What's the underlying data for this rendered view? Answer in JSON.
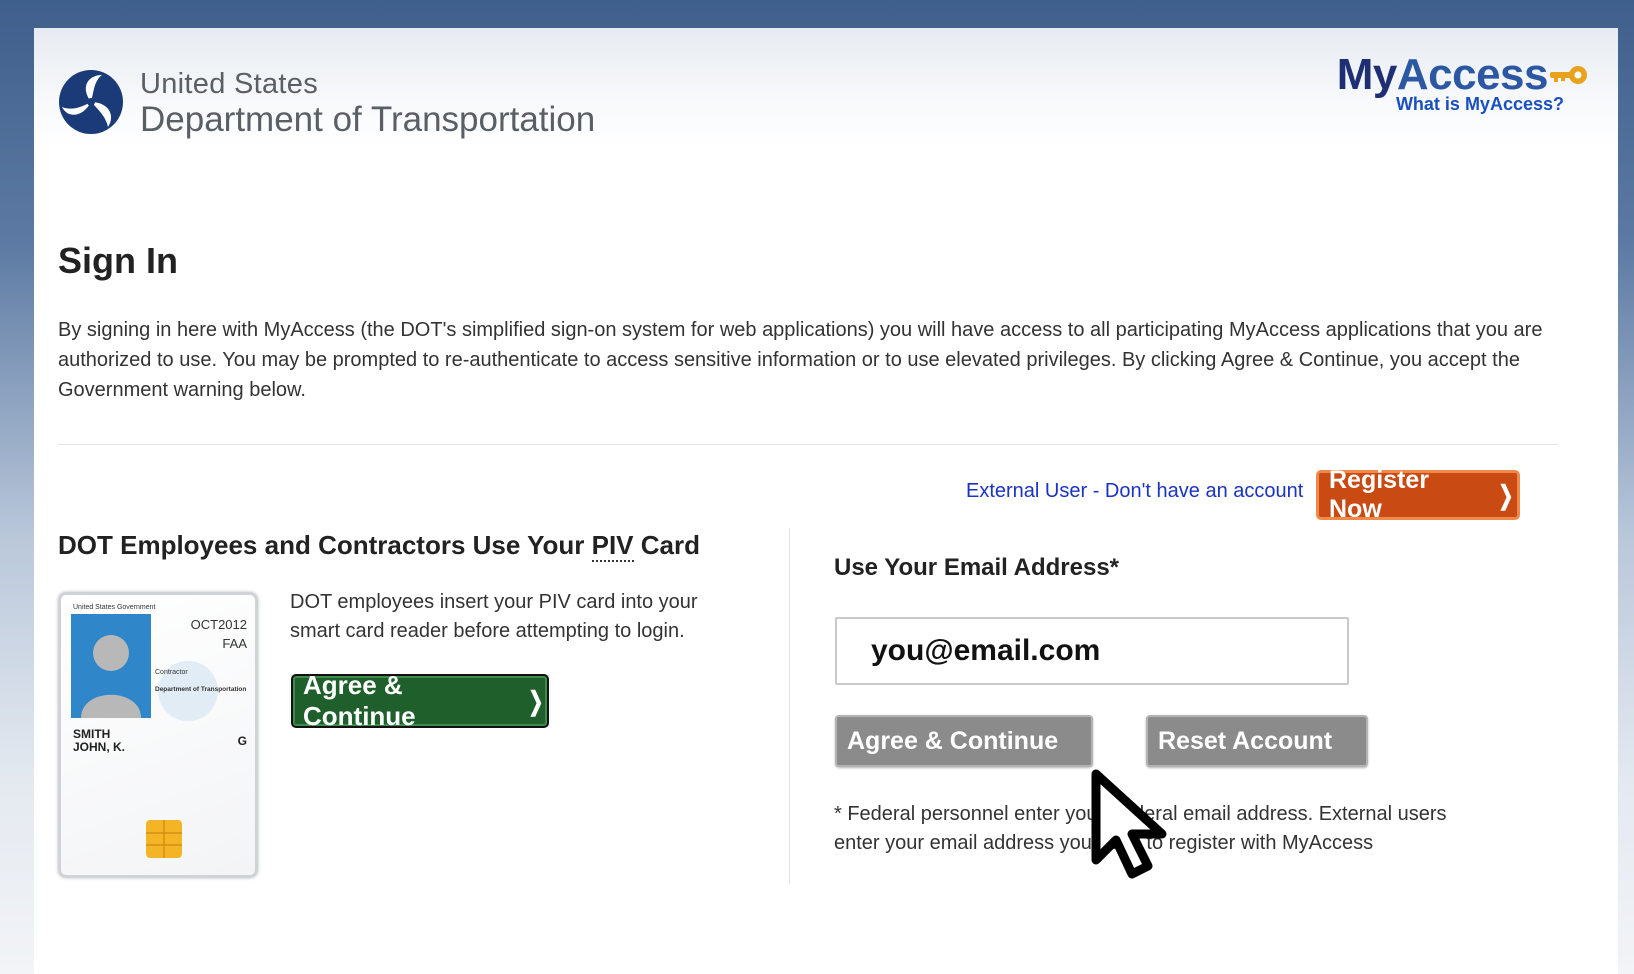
{
  "header": {
    "agency_line1": "United States",
    "agency_line2": "Department of Transportation",
    "brand_my": "My",
    "brand_access": "Access",
    "what_link": "What is MyAccess?"
  },
  "signin": {
    "title": "Sign In",
    "intro": "By signing in here with MyAccess (the DOT's simplified sign-on system for web applications) you will have access to all participating MyAccess applications that you are authorized to use. You may be prompted to re-authenticate to access sensitive information or to use elevated privileges. By clicking Agree & Continue, you accept the Government warning below."
  },
  "external": {
    "link_text": "External User - Don't have an account",
    "register_label": "Register Now"
  },
  "piv": {
    "title_prefix": "DOT Employees and Contractors Use Your ",
    "title_abbr": "PIV",
    "title_suffix": " Card",
    "description": "DOT employees insert your PIV card into your smart card reader before attempting to login.",
    "agree_label": "Agree & Continue",
    "card": {
      "issuer": "United States Government",
      "date": "OCT2012",
      "agency": "FAA",
      "affiliation": "Contractor",
      "dept": "Department of Transportation",
      "last_name": "SMITH",
      "first_name": "JOHN, K.",
      "grade": "G"
    }
  },
  "email": {
    "title": "Use Your Email Address*",
    "input_value": "you@email.com",
    "agree_label": "Agree & Continue",
    "reset_label": "Reset Account",
    "note": "* Federal personnel enter your Federal email address. External users enter your email address you used to register with MyAccess"
  },
  "colors": {
    "brand_dark": "#1f2f73",
    "brand_blue": "#2c57a3",
    "register_orange": "#c94a12",
    "agree_green": "#1f5f2c",
    "button_gray": "#8b8b8b",
    "link_blue": "#1b33c4"
  }
}
